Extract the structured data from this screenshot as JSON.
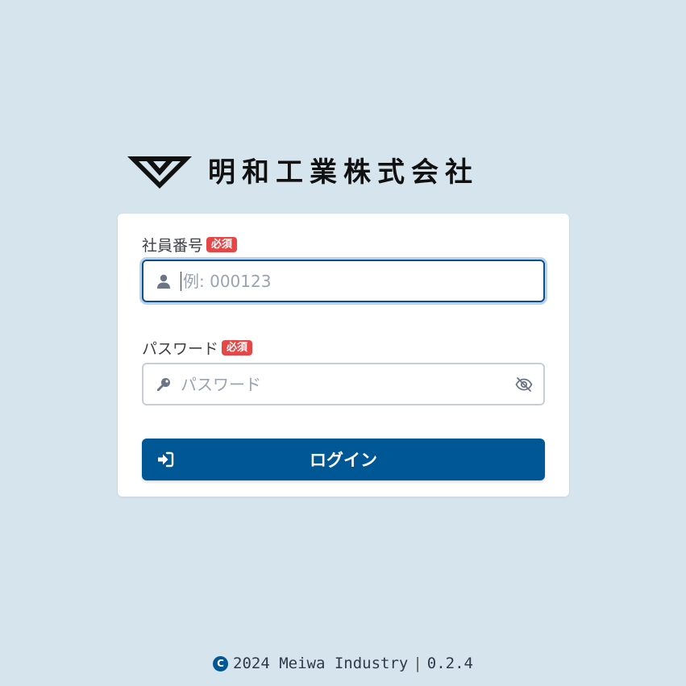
{
  "brand": {
    "company_name": "明和工業株式会社",
    "logo_icon": "meiwa-v-logo-icon"
  },
  "form": {
    "employee_id": {
      "label": "社員番号",
      "required_badge": "必須",
      "placeholder": "例: 000123",
      "value": "",
      "icon": "user-icon"
    },
    "password": {
      "label": "パスワード",
      "required_badge": "必須",
      "placeholder": "パスワード",
      "value": "",
      "icon": "key-icon",
      "toggle_icon": "eye-slash-icon"
    },
    "login_button": {
      "label": "ログイン",
      "icon": "sign-in-icon"
    }
  },
  "footer": {
    "copyright_icon": "copyright-icon",
    "copyright_symbol": "C",
    "copyright_text": "2024 Meiwa Industry",
    "separator": "|",
    "version": "0.2.4"
  },
  "colors": {
    "background": "#d6e4ee",
    "primary": "#005796",
    "badge": "#e64646",
    "focus_border": "#0b4f8c"
  }
}
